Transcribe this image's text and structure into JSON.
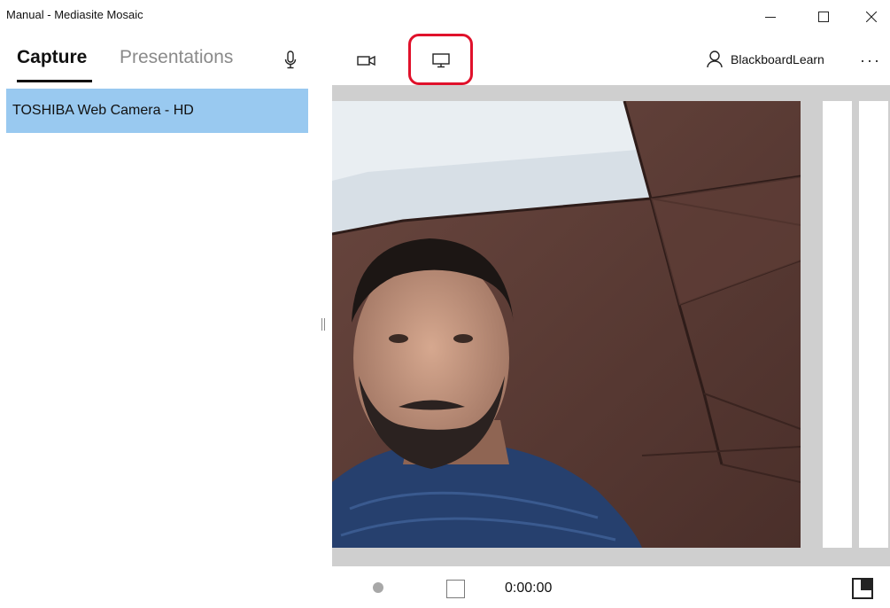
{
  "window": {
    "title": "Manual - Mediasite Mosaic",
    "controls": {
      "minimize_icon": "minimize-icon",
      "maximize_icon": "maximize-icon",
      "close_icon": "close-icon"
    }
  },
  "tabs": [
    {
      "label": "Capture",
      "active": true
    },
    {
      "label": "Presentations",
      "active": false
    }
  ],
  "sources": [
    {
      "name": "microphone",
      "icon": "microphone-icon",
      "selected": false
    },
    {
      "name": "camera",
      "icon": "video-camera-icon",
      "selected": false
    },
    {
      "name": "screen",
      "icon": "monitor-icon",
      "selected": true,
      "highlighted": true
    }
  ],
  "user": {
    "name": "BlackboardLearn",
    "icon": "person-icon"
  },
  "more_menu": {
    "label": "···"
  },
  "devices": [
    {
      "label": "TOSHIBA Web Camera - HD",
      "selected": true
    }
  ],
  "preview": {
    "content": "webcam-feed"
  },
  "recorder": {
    "record_icon": "record-icon",
    "stop_icon": "stop-icon",
    "elapsed": "0:00:00",
    "layout_icon": "layout-toggle-icon"
  },
  "colors": {
    "selection": "#99c9f0",
    "highlight": "#e0112b",
    "preview_background": "#cfcfcf"
  }
}
